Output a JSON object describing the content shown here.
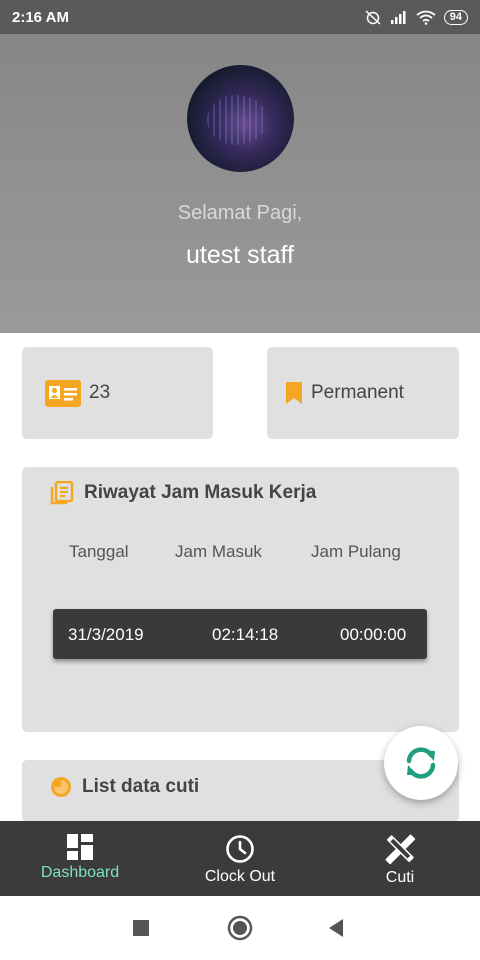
{
  "status_bar": {
    "time": "2:16 AM",
    "battery": "94"
  },
  "header": {
    "greeting": "Selamat Pagi,",
    "username": "utest staff"
  },
  "cards": {
    "id_value": "23",
    "employment_status": "Permanent"
  },
  "history": {
    "title": "Riwayat Jam Masuk Kerja",
    "columns": [
      "Tanggal",
      "Jam Masuk",
      "Jam Pulang"
    ],
    "rows": [
      {
        "date": "31/3/2019",
        "clock_in": "02:14:18",
        "clock_out": "00:00:00"
      }
    ]
  },
  "leave": {
    "title": "List data cuti"
  },
  "bottom_nav": [
    {
      "label": "Dashboard",
      "icon": "dashboard-icon",
      "active": true
    },
    {
      "label": "Clock Out",
      "icon": "clock-icon",
      "active": false
    },
    {
      "label": "Cuti",
      "icon": "edit-tools-icon",
      "active": false
    }
  ],
  "colors": {
    "accent_orange": "#f5a623",
    "accent_teal": "#1f9f7f",
    "active_nav": "#7ee0c8",
    "nav_bg": "#3b3b3b"
  }
}
